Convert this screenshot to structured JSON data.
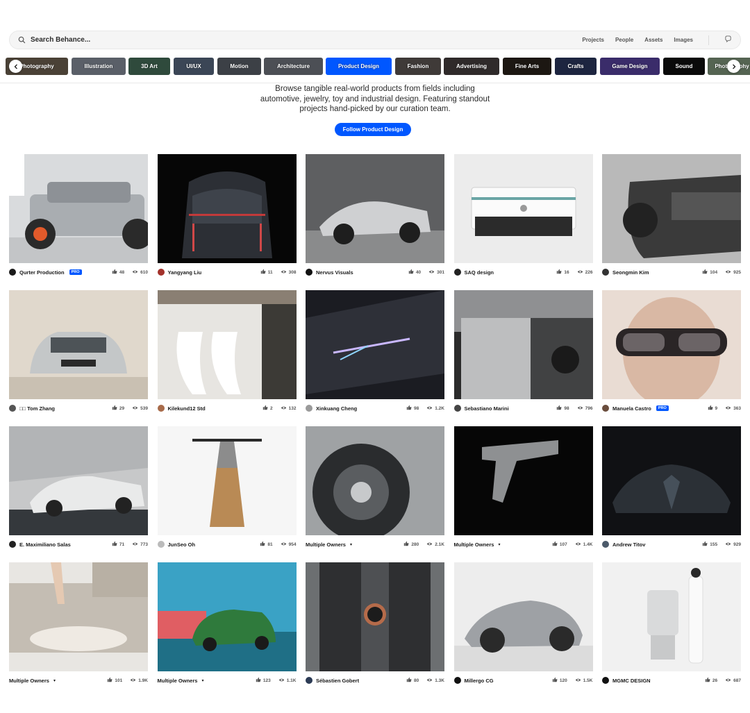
{
  "search": {
    "placeholder": "Search Behance...",
    "scopes": [
      "Projects",
      "People",
      "Assets",
      "Images"
    ]
  },
  "categories": [
    {
      "label": "Photography",
      "bg": "#4a4136"
    },
    {
      "label": "Illustration",
      "bg": "#5a5f68"
    },
    {
      "label": "3D Art",
      "bg": "#2f4a3c"
    },
    {
      "label": "UI/UX",
      "bg": "#3b4656"
    },
    {
      "label": "Motion",
      "bg": "#3c4046"
    },
    {
      "label": "Architecture",
      "bg": "#4c4f55"
    },
    {
      "label": "Product Design",
      "bg": "#0057ff"
    },
    {
      "label": "Fashion",
      "bg": "#3f3a38"
    },
    {
      "label": "Advertising",
      "bg": "#2f2a2a"
    },
    {
      "label": "Fine Arts",
      "bg": "#1c1712"
    },
    {
      "label": "Crafts",
      "bg": "#1d2540"
    },
    {
      "label": "Game Design",
      "bg": "#3a2c6a"
    },
    {
      "label": "Sound",
      "bg": "#0a0a0a"
    },
    {
      "label": "Photography",
      "bg": "#556452"
    }
  ],
  "intro": {
    "lines": [
      "Browse tangible real-world products from fields including",
      "automotive, jewelry, toy and industrial design. Featuring standout",
      "projects hand-picked by our curation team."
    ],
    "follow_label": "Follow Product Design"
  },
  "projects": [
    {
      "owner": "Qurter Production",
      "pro": true,
      "likes": "48",
      "views": "610",
      "avatar": "#1a1a1a",
      "image": "suv"
    },
    {
      "owner": "Yangyang Liu",
      "pro": false,
      "likes": "11",
      "views": "308",
      "avatar": "#a3322b",
      "image": "van"
    },
    {
      "owner": "Nervus Visuals",
      "pro": false,
      "likes": "40",
      "views": "301",
      "avatar": "#111111",
      "image": "racecar"
    },
    {
      "owner": "SAQ design",
      "pro": false,
      "likes": "16",
      "views": "226",
      "avatar": "#222222",
      "image": "device"
    },
    {
      "owner": "Seongmin Kim",
      "pro": false,
      "likes": "104",
      "views": "925",
      "avatar": "#333333",
      "image": "bwcar"
    },
    {
      "owner": "□□ Tom Zhang",
      "pro": false,
      "likes": "29",
      "views": "539",
      "avatar": "#555555",
      "image": "audi"
    },
    {
      "owner": "Kilekund12 Std",
      "pro": false,
      "likes": "2",
      "views": "132",
      "avatar": "#a86b4a",
      "image": "ceramic"
    },
    {
      "owner": "Xinkuang Cheng",
      "pro": false,
      "likes": "98",
      "views": "1.2K",
      "avatar": "#9a9a9a",
      "image": "neon"
    },
    {
      "owner": "Sebastiano Marini",
      "pro": false,
      "likes": "98",
      "views": "796",
      "avatar": "#444444",
      "image": "box"
    },
    {
      "owner": "Manuela Castro",
      "pro": true,
      "likes": "9",
      "views": "363",
      "avatar": "#6a4d3d",
      "image": "glasses"
    },
    {
      "owner": "E. Maximiliano Salas",
      "pro": false,
      "likes": "71",
      "views": "773",
      "avatar": "#222222",
      "image": "sedan"
    },
    {
      "owner": "JunSeo Oh",
      "pro": false,
      "likes": "81",
      "views": "954",
      "avatar": "#bbbbbb",
      "image": "lamp"
    },
    {
      "owner": "Multiple Owners",
      "multi": true,
      "pro": false,
      "likes": "280",
      "views": "2.1K",
      "avatar": "",
      "image": "wheel"
    },
    {
      "owner": "Multiple Owners",
      "multi": true,
      "pro": false,
      "likes": "107",
      "views": "1.4K",
      "avatar": "",
      "image": "gun"
    },
    {
      "owner": "Andrew Titov",
      "pro": false,
      "likes": "155",
      "views": "929",
      "avatar": "#4c5a6a",
      "image": "bugatti"
    },
    {
      "owner": "Multiple Owners",
      "multi": true,
      "pro": false,
      "likes": "101",
      "views": "1.9K",
      "avatar": "",
      "image": "panel"
    },
    {
      "owner": "Multiple Owners",
      "multi": true,
      "pro": false,
      "likes": "123",
      "views": "1.1K",
      "avatar": "",
      "image": "greencar"
    },
    {
      "owner": "Sébastien Gobert",
      "pro": false,
      "likes": "80",
      "views": "1.3K",
      "avatar": "#2c3b55",
      "image": "watch"
    },
    {
      "owner": "Millergo CG",
      "pro": false,
      "likes": "120",
      "views": "1.5K",
      "avatar": "#111111",
      "image": "pagani"
    },
    {
      "owner": "MGMC DESIGN",
      "pro": false,
      "likes": "26",
      "views": "687",
      "avatar": "#111111",
      "image": "chair"
    }
  ],
  "pro_label": "PRO",
  "icons": {
    "search": "search-icon",
    "like": "thumbs-up-icon",
    "view": "eye-icon",
    "prev": "chevron-left-icon",
    "next": "chevron-right-icon",
    "image_search": "image-search-icon"
  }
}
